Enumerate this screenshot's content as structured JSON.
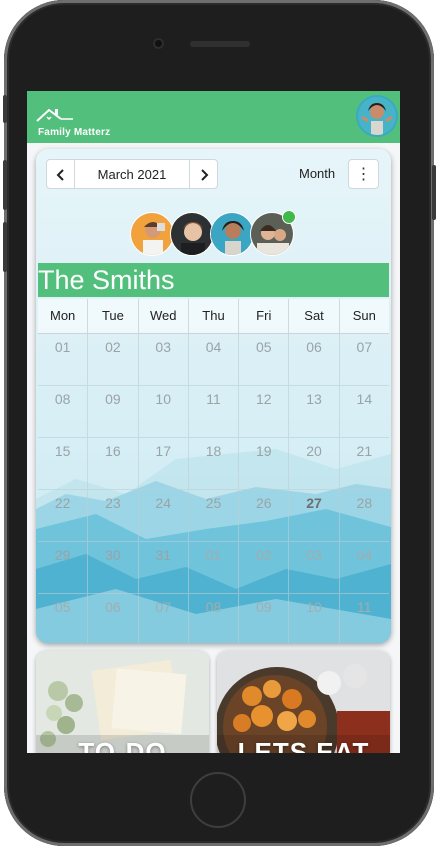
{
  "app": {
    "name": "Family Matterz"
  },
  "calendar": {
    "current_month": "March 2021",
    "view_mode": "Month",
    "more_icon": "⋮",
    "family_name": "The Smiths",
    "weekdays": [
      "Mon",
      "Tue",
      "Wed",
      "Thu",
      "Fri",
      "Sat",
      "Sun"
    ],
    "weeks": [
      [
        "01",
        "02",
        "03",
        "04",
        "05",
        "06",
        "07"
      ],
      [
        "08",
        "09",
        "10",
        "11",
        "12",
        "13",
        "14"
      ],
      [
        "15",
        "16",
        "17",
        "18",
        "19",
        "20",
        "21"
      ],
      [
        "22",
        "23",
        "24",
        "25",
        "26",
        "27",
        "28"
      ],
      [
        "29",
        "30",
        "31",
        "01",
        "02",
        "03",
        "04"
      ],
      [
        "05",
        "06",
        "07",
        "08",
        "09",
        "10",
        "11"
      ]
    ],
    "today": "27",
    "members_count_shown": 4
  },
  "tiles": {
    "todo_title": "TO-DO",
    "food_title": "LETS EAT"
  },
  "colors": {
    "brand_green": "#52c07c",
    "online": "#40b94a"
  },
  "icons": {
    "prev": "chevron-left-icon",
    "next": "chevron-right-icon",
    "more": "more-vertical-icon",
    "logo": "house-icon"
  }
}
